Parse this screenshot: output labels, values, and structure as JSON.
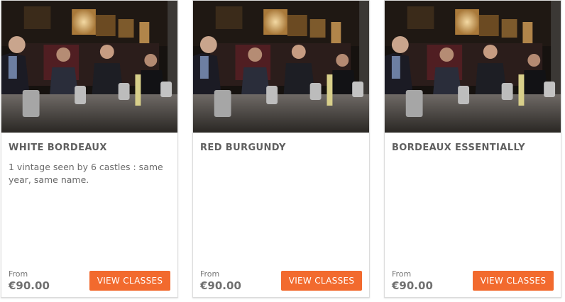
{
  "accent_color": "#f26a2e",
  "cards": [
    {
      "title": "WHITE BORDEAUX",
      "description": "1 vintage seen by 6 castles : same year, same name.",
      "price_label": "From",
      "price": "€90.00",
      "button_label": "VIEW CLASSES"
    },
    {
      "title": "RED BURGUNDY",
      "description": "",
      "price_label": "From",
      "price": "€90.00",
      "button_label": "VIEW CLASSES"
    },
    {
      "title": "BORDEAUX ESSENTIALLY",
      "description": "",
      "price_label": "From",
      "price": "€90.00",
      "button_label": "VIEW CLASSES"
    }
  ]
}
